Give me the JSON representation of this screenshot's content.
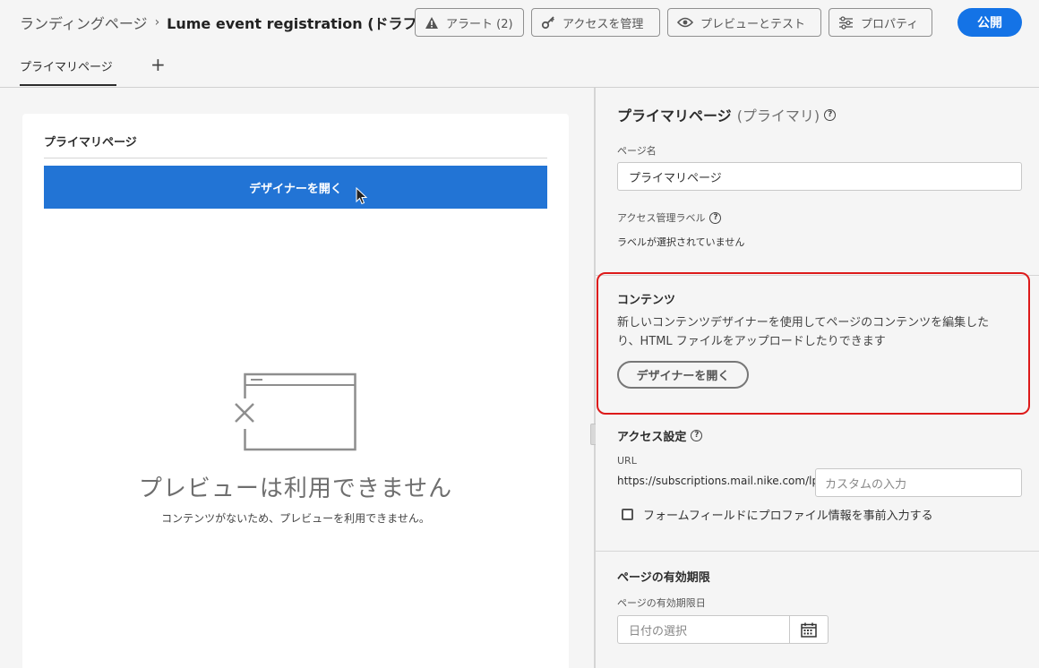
{
  "header": {
    "breadcrumb_parent": "ランディングページ",
    "breadcrumb_separator": "›",
    "title": "Lume event registration (ドラフト)",
    "alerts_label": "アラート (2)",
    "manage_access_label": "アクセスを管理",
    "preview_test_label": "プレビューとテスト",
    "properties_label": "プロパティ",
    "publish_label": "公開"
  },
  "tabs": {
    "primary_label": "プライマリページ",
    "add_label": "+"
  },
  "left_panel": {
    "card_title": "プライマリページ",
    "open_designer_label": "デザイナーを開く",
    "preview_unavailable_title": "プレビューは利用できません",
    "preview_unavailable_sub": "コンテンツがないため、プレビューを利用できません。"
  },
  "right_panel": {
    "title": "プライマリページ",
    "title_suffix": "(プライマリ)",
    "page_name_label": "ページ名",
    "page_name_value": "プライマリページ",
    "access_label_title": "アクセス管理ラベル",
    "access_label_value": "ラベルが選択されていません",
    "content": {
      "title": "コンテンツ",
      "description": "新しいコンテンツデザイナーを使用してページのコンテンツを編集したり、HTML ファイルをアップロードしたりできます",
      "open_designer_label": "デザイナーを開く"
    },
    "access_settings": {
      "title": "アクセス設定",
      "url_label": "URL",
      "url_prefix": "https://subscriptions.mail.nike.com/lp/",
      "custom_placeholder": "カスタムの入力",
      "prefill_label": "フォームフィールドにプロファイル情報を事前入力する",
      "prefill_checked": false
    },
    "expiration": {
      "title": "ページの有効期限",
      "date_label": "ページの有効期限日",
      "date_placeholder": "日付の選択"
    }
  },
  "colors": {
    "accent": "#1473e6",
    "designer_bar": "#2274d5",
    "highlight": "#dd1a1a"
  }
}
